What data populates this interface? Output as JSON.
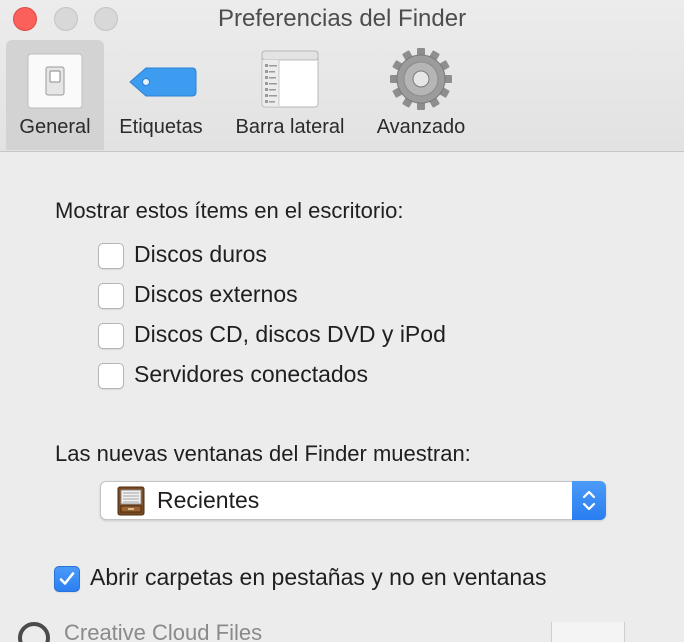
{
  "window": {
    "title": "Preferencias del Finder"
  },
  "toolbar": {
    "tabs": [
      {
        "label": "General",
        "icon": "switch-icon",
        "active": true
      },
      {
        "label": "Etiquetas",
        "icon": "tag-icon",
        "active": false
      },
      {
        "label": "Barra lateral",
        "icon": "sidebar-icon",
        "active": false
      },
      {
        "label": "Avanzado",
        "icon": "gear-icon",
        "active": false
      }
    ]
  },
  "desktop_items": {
    "heading": "Mostrar estos ítems en el escritorio:",
    "options": [
      {
        "label": "Discos duros",
        "checked": false
      },
      {
        "label": "Discos externos",
        "checked": false
      },
      {
        "label": "Discos CD, discos DVD y iPod",
        "checked": false
      },
      {
        "label": "Servidores conectados",
        "checked": false
      }
    ]
  },
  "new_windows": {
    "heading": "Las nuevas ventanas del Finder muestran:",
    "selected": "Recientes",
    "icon": "recents-cabinet-icon"
  },
  "open_in_tabs": {
    "label": "Abrir carpetas en pestañas y no en ventanas",
    "checked": true
  },
  "background": {
    "text": "Creative Cloud Files"
  },
  "colors": {
    "accent": "#3b8cf5",
    "close": "#fc605b",
    "active_tab": "#d3d3d3"
  }
}
